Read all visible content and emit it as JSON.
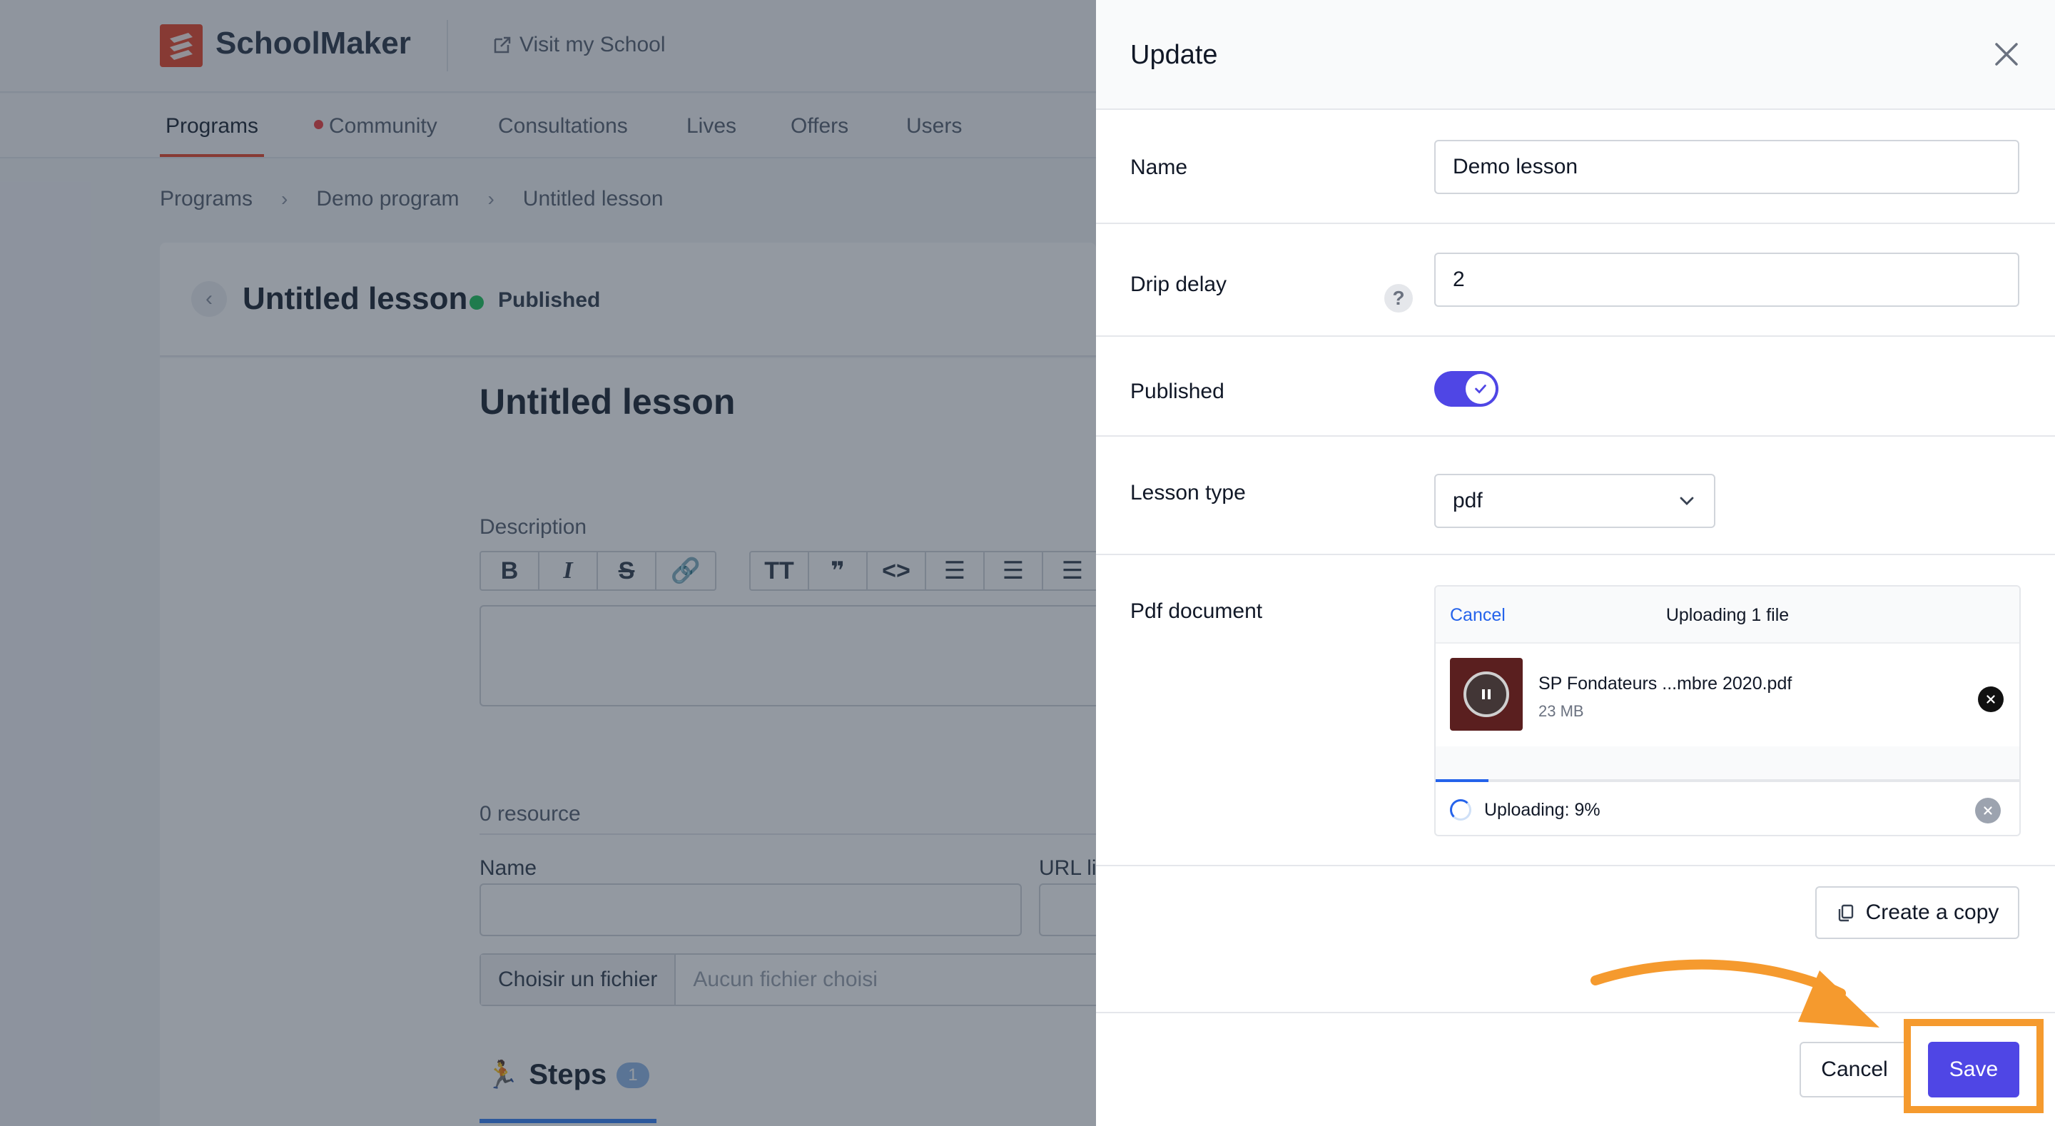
{
  "app": {
    "brand": "SchoolMaker",
    "visit_label": "Visit my School",
    "nav": [
      "Programs",
      "Community",
      "Consultations",
      "Lives",
      "Offers",
      "Users"
    ],
    "breadcrumbs": [
      "Programs",
      "Demo program",
      "Untitled lesson"
    ],
    "lesson_title": "Untitled lesson",
    "status": "Published",
    "editor_title": "Untitled lesson",
    "description_label": "Description",
    "resource_count": "0 resource",
    "resource_name_label": "Name",
    "resource_url_label": "URL li",
    "file_button": "Choisir un fichier",
    "file_none": "Aucun fichier choisi",
    "steps_label": "Steps",
    "steps_count": "1"
  },
  "panel": {
    "title": "Update",
    "name_label": "Name",
    "name_value": "Demo lesson",
    "drip_label": "Drip delay",
    "drip_value": "2",
    "help": "?",
    "published_label": "Published",
    "published_on": true,
    "lesson_type_label": "Lesson type",
    "lesson_type_value": "pdf",
    "pdf_label": "Pdf document",
    "uploader": {
      "cancel": "Cancel",
      "title": "Uploading 1 file",
      "file_name": "SP Fondateurs ...mbre 2020.pdf",
      "file_size": "23 MB",
      "status": "Uploading: 9%",
      "progress": 0.09
    },
    "copy_button": "Create a copy",
    "cancel_button": "Cancel",
    "save_button": "Save"
  },
  "colors": {
    "accent": "#4f46e5",
    "brand": "#e9492f",
    "highlight": "#f59a2e",
    "link": "#2563eb"
  }
}
